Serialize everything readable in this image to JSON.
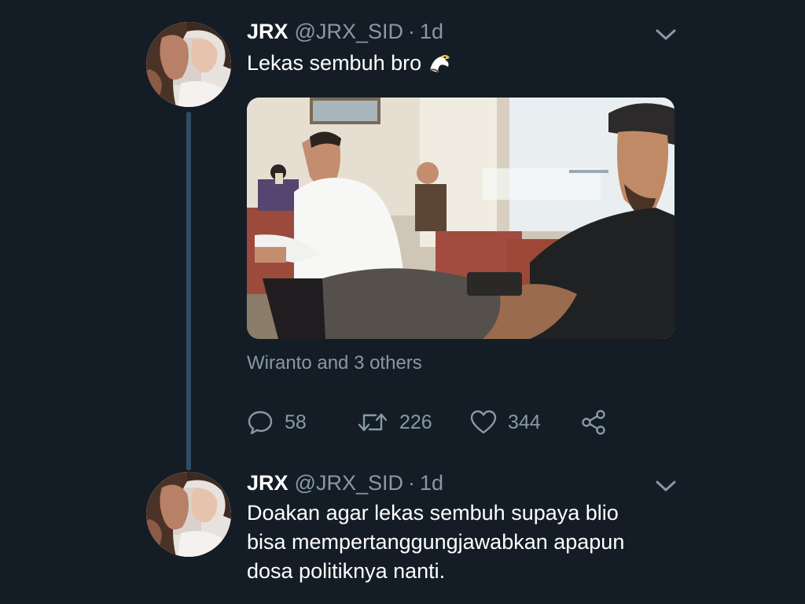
{
  "thread": [
    {
      "author": {
        "name": "JRX",
        "handle": "@JRX_SID"
      },
      "separator": "·",
      "time": "1d",
      "text_lines": [
        "Lekas sembuh bro"
      ],
      "emoji": "eagle-emoji",
      "tagged": "Wiranto and 3 others",
      "stats": {
        "replies": "58",
        "retweets": "226",
        "likes": "344"
      }
    },
    {
      "author": {
        "name": "JRX",
        "handle": "@JRX_SID"
      },
      "separator": "·",
      "time": "1d",
      "text_lines": [
        "Doakan agar lekas sembuh supaya blio",
        "bisa mempertanggungjawabkan apapun",
        "dosa politiknya nanti."
      ]
    }
  ],
  "colors": {
    "background": "#141d26",
    "secondary_text": "#8899a6",
    "thread_line": "#2f4d65",
    "primary_text": "#ffffff"
  },
  "icons": {
    "reply": "reply-icon",
    "retweet": "retweet-icon",
    "like": "like-icon",
    "share": "share-icon",
    "menu": "chevron-down-icon"
  }
}
